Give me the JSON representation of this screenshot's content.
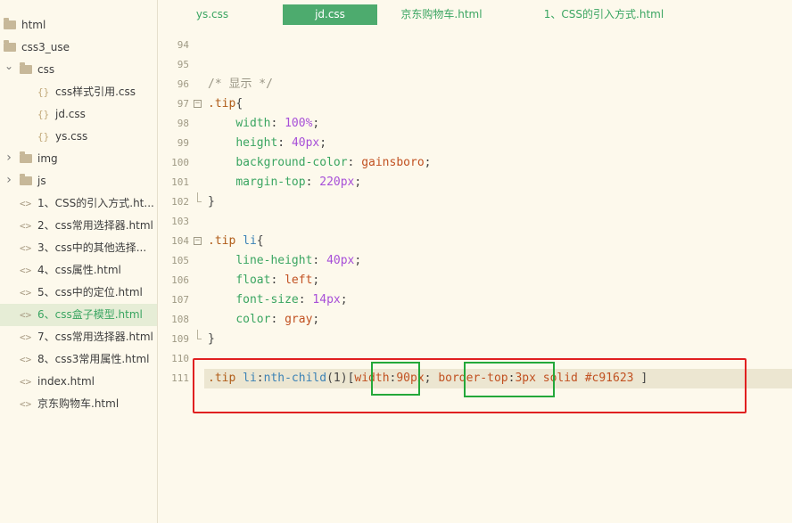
{
  "sidebar": {
    "items": [
      {
        "label": "html",
        "kind": "folder",
        "depth": 0,
        "expanded": null
      },
      {
        "label": "css3_use",
        "kind": "folder",
        "depth": 0,
        "expanded": null
      },
      {
        "label": "css",
        "kind": "folder",
        "depth": 1,
        "expanded": true
      },
      {
        "label": "css样式引用.css",
        "kind": "css",
        "depth": 2
      },
      {
        "label": "jd.css",
        "kind": "css",
        "depth": 2
      },
      {
        "label": "ys.css",
        "kind": "css",
        "depth": 2
      },
      {
        "label": "img",
        "kind": "folder",
        "depth": 1,
        "expanded": false
      },
      {
        "label": "js",
        "kind": "folder",
        "depth": 1,
        "expanded": false
      },
      {
        "label": "1、CSS的引入方式.ht...",
        "kind": "html",
        "depth": 1
      },
      {
        "label": "2、css常用选择器.html",
        "kind": "html",
        "depth": 1
      },
      {
        "label": "3、css中的其他选择...",
        "kind": "html",
        "depth": 1
      },
      {
        "label": "4、css属性.html",
        "kind": "html",
        "depth": 1
      },
      {
        "label": "5、css中的定位.html",
        "kind": "html",
        "depth": 1
      },
      {
        "label": "6、css盒子模型.html",
        "kind": "html",
        "depth": 1,
        "active": true
      },
      {
        "label": "7、css常用选择器.html",
        "kind": "html",
        "depth": 1
      },
      {
        "label": "8、css3常用属性.html",
        "kind": "html",
        "depth": 1
      },
      {
        "label": "index.html",
        "kind": "html",
        "depth": 1
      },
      {
        "label": "京东购物车.html",
        "kind": "html",
        "depth": 1
      }
    ]
  },
  "tabs": [
    {
      "label": "ys.css",
      "active": false
    },
    {
      "label": "jd.css",
      "active": true
    },
    {
      "label": "京东购物车.html",
      "active": false
    },
    {
      "label": "1、CSS的引入方式.html",
      "active": false
    }
  ],
  "editor": {
    "lines": [
      {
        "n": "94",
        "tokens": []
      },
      {
        "n": "95",
        "tokens": []
      },
      {
        "n": "96",
        "tokens": [
          [
            "c-comment",
            "/* 显示 */"
          ]
        ]
      },
      {
        "n": "97",
        "fold": "open",
        "tokens": [
          [
            "c-sel",
            ".tip"
          ],
          [
            "c-punc",
            "{"
          ]
        ]
      },
      {
        "n": "98",
        "tokens": [
          [
            "c-punc",
            "    "
          ],
          [
            "c-prop",
            "width"
          ],
          [
            "c-punc",
            ": "
          ],
          [
            "c-num",
            "100%"
          ],
          [
            "c-punc",
            ";"
          ]
        ]
      },
      {
        "n": "99",
        "tokens": [
          [
            "c-punc",
            "    "
          ],
          [
            "c-prop",
            "height"
          ],
          [
            "c-punc",
            ": "
          ],
          [
            "c-num",
            "40px"
          ],
          [
            "c-punc",
            ";"
          ]
        ]
      },
      {
        "n": "100",
        "tokens": [
          [
            "c-punc",
            "    "
          ],
          [
            "c-prop",
            "background-color"
          ],
          [
            "c-punc",
            ": "
          ],
          [
            "c-str",
            "gainsboro"
          ],
          [
            "c-punc",
            ";"
          ]
        ]
      },
      {
        "n": "101",
        "tokens": [
          [
            "c-punc",
            "    "
          ],
          [
            "c-prop",
            "margin-top"
          ],
          [
            "c-punc",
            ": "
          ],
          [
            "c-num",
            "220px"
          ],
          [
            "c-punc",
            ";"
          ]
        ]
      },
      {
        "n": "102",
        "fold": "end",
        "tokens": [
          [
            "c-punc",
            "}"
          ]
        ]
      },
      {
        "n": "103",
        "tokens": []
      },
      {
        "n": "104",
        "fold": "open",
        "tokens": [
          [
            "c-sel",
            ".tip"
          ],
          [
            "c-punc",
            " "
          ],
          [
            "c-tag",
            "li"
          ],
          [
            "c-punc",
            "{"
          ]
        ]
      },
      {
        "n": "105",
        "tokens": [
          [
            "c-punc",
            "    "
          ],
          [
            "c-prop",
            "line-height"
          ],
          [
            "c-punc",
            ": "
          ],
          [
            "c-num",
            "40px"
          ],
          [
            "c-punc",
            ";"
          ]
        ]
      },
      {
        "n": "106",
        "tokens": [
          [
            "c-punc",
            "    "
          ],
          [
            "c-prop",
            "float"
          ],
          [
            "c-punc",
            ": "
          ],
          [
            "c-str",
            "left"
          ],
          [
            "c-punc",
            ";"
          ]
        ]
      },
      {
        "n": "107",
        "tokens": [
          [
            "c-punc",
            "    "
          ],
          [
            "c-prop",
            "font-size"
          ],
          [
            "c-punc",
            ": "
          ],
          [
            "c-num",
            "14px"
          ],
          [
            "c-punc",
            ";"
          ]
        ]
      },
      {
        "n": "108",
        "tokens": [
          [
            "c-punc",
            "    "
          ],
          [
            "c-prop",
            "color"
          ],
          [
            "c-punc",
            ": "
          ],
          [
            "c-str",
            "gray"
          ],
          [
            "c-punc",
            ";"
          ]
        ]
      },
      {
        "n": "109",
        "fold": "end",
        "tokens": [
          [
            "c-punc",
            "}"
          ]
        ]
      },
      {
        "n": "110",
        "tokens": []
      },
      {
        "n": "111",
        "highlight": true,
        "tokens": [
          [
            "c-sel",
            ".tip"
          ],
          [
            "c-punc",
            " "
          ],
          [
            "c-tag",
            "li"
          ],
          [
            "c-punc",
            ":"
          ],
          [
            "c-tag",
            "nth-child"
          ],
          [
            "c-punc",
            "(1)"
          ],
          [
            "c-punc",
            "["
          ],
          [
            "c-str",
            "width"
          ],
          [
            "c-punc",
            ":"
          ],
          [
            "c-str",
            "90px"
          ],
          [
            "c-punc",
            "; "
          ],
          [
            "c-str",
            "border-top"
          ],
          [
            "c-punc",
            ":"
          ],
          [
            "c-str",
            "3px solid #c91623"
          ],
          [
            "c-punc",
            " ]"
          ]
        ]
      }
    ]
  },
  "colors": {
    "accent": "#4dab6e",
    "annotation_red": "#e02020",
    "annotation_green": "#24a83a",
    "background": "#fdf9ec"
  }
}
